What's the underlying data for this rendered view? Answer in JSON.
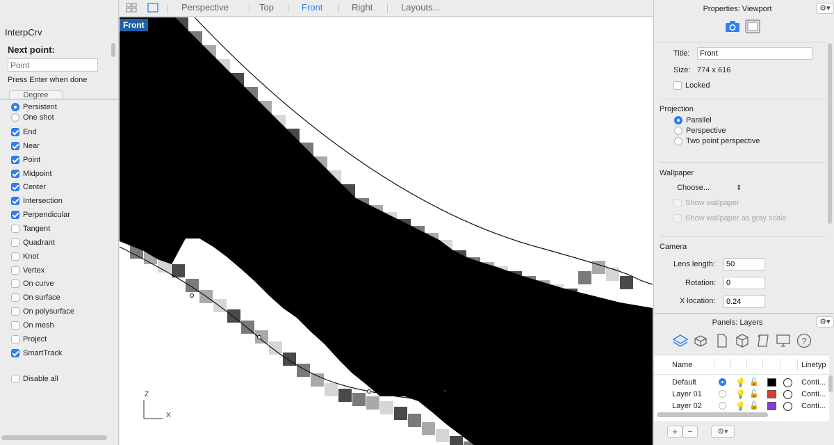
{
  "command": {
    "name": "InterpCrv",
    "prompt": "Next point:",
    "input_placeholder": "Point",
    "hint": "Press Enter when done",
    "degree_label": "Degree"
  },
  "osnap": {
    "mode_options": [
      {
        "label": "Persistent",
        "selected": true
      },
      {
        "label": "One shot",
        "selected": false
      }
    ],
    "items": [
      {
        "label": "End",
        "checked": true
      },
      {
        "label": "Near",
        "checked": true
      },
      {
        "label": "Point",
        "checked": true
      },
      {
        "label": "Midpoint",
        "checked": true
      },
      {
        "label": "Center",
        "checked": true
      },
      {
        "label": "Intersection",
        "checked": true
      },
      {
        "label": "Perpendicular",
        "checked": true
      },
      {
        "label": "Tangent",
        "checked": false
      },
      {
        "label": "Quadrant",
        "checked": false
      },
      {
        "label": "Knot",
        "checked": false
      },
      {
        "label": "Vertex",
        "checked": false
      },
      {
        "label": "On curve",
        "checked": false
      },
      {
        "label": "On surface",
        "checked": false
      },
      {
        "label": "On polysurface",
        "checked": false
      },
      {
        "label": "On mesh",
        "checked": false
      },
      {
        "label": "Project",
        "checked": false
      },
      {
        "label": "SmartTrack",
        "checked": true
      }
    ],
    "disable_all": {
      "label": "Disable all",
      "checked": false
    }
  },
  "toolbar": {
    "tabs": [
      {
        "label": "Perspective",
        "active": false
      },
      {
        "label": "Top",
        "active": false
      },
      {
        "label": "Front",
        "active": true
      },
      {
        "label": "Right",
        "active": false
      },
      {
        "label": "Layouts...",
        "active": false
      }
    ]
  },
  "viewport": {
    "label": "Front",
    "axis_z": "Z",
    "axis_x": "X"
  },
  "properties": {
    "title": "Properties: Viewport",
    "title_label": "Title:",
    "title_value": "Front",
    "size_label": "Size:",
    "size_value": "774 x 616",
    "locked_label": "Locked",
    "locked": false,
    "projection_heading": "Projection",
    "projection_options": [
      {
        "label": "Parallel",
        "selected": true
      },
      {
        "label": "Perspective",
        "selected": false
      },
      {
        "label": "Two point perspective",
        "selected": false
      }
    ],
    "wallpaper_heading": "Wallpaper",
    "wallpaper_choose": "Choose...",
    "show_wallpaper": "Show wallpaper",
    "show_wallpaper_gray": "Show wallpaper as gray scale",
    "camera_heading": "Camera",
    "lens_label": "Lens length:",
    "lens_value": "50",
    "rotation_label": "Rotation:",
    "rotation_value": "0",
    "xloc_label": "X location:",
    "xloc_value": "0.24"
  },
  "layers": {
    "title": "Panels: Layers",
    "col_name": "Name",
    "col_linetype": "Linetyp",
    "rows": [
      {
        "name": "Default",
        "current": true,
        "color": "#000000",
        "linetype": "Conti..."
      },
      {
        "name": "Layer 01",
        "current": false,
        "color": "#e03a2e",
        "linetype": "Conti..."
      },
      {
        "name": "Layer 02",
        "current": false,
        "color": "#8a3bd6",
        "linetype": "Conti..."
      }
    ],
    "add_label": "+",
    "remove_label": "−"
  },
  "colors": {
    "accent": "#2f7ff5",
    "viewport_label_bg": "#1f5fa8"
  }
}
